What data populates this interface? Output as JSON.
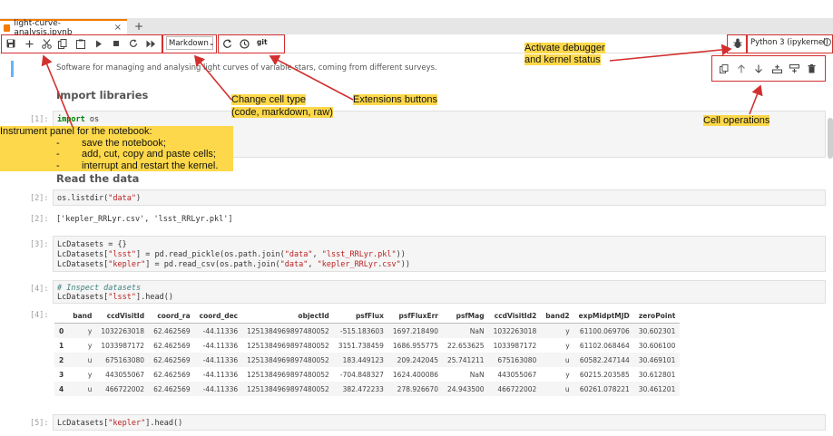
{
  "tab": {
    "title": "light-curve-analysis.ipynb",
    "close_glyph": "×",
    "new_tab_glyph": "+"
  },
  "toolbar": {
    "cell_type_value": "Markdown",
    "git_label": "git",
    "kernel_name": "Python 3 (ipykernel)",
    "icons": [
      "save-icon",
      "add-icon",
      "cut-icon",
      "copy-icon",
      "paste-icon",
      "run-icon",
      "stop-icon",
      "restart-icon",
      "fast-forward-icon",
      "refresh-icon",
      "clock-icon",
      "git-icon",
      "bug-icon",
      "kernel-status-icon"
    ]
  },
  "cell_ops": {
    "icons": [
      "duplicate-icon",
      "move-up-icon",
      "move-down-icon",
      "insert-above-icon",
      "insert-below-icon",
      "delete-icon"
    ]
  },
  "notebook": {
    "intro": "Software for managing and analysing light curves of variable stars, coming from different surveys.",
    "heading_import": "Import libraries",
    "heading_read": "Read the data",
    "cell1": {
      "prompt": "[1]:",
      "kw": "import",
      "rest": " os"
    },
    "cell2": {
      "prompt": "[2]:",
      "code_fn": "os.listdir(",
      "code_str": "\"data\"",
      "code_end": ")"
    },
    "out2": {
      "prompt": "[2]:",
      "text": "['kepler_RRLyr.csv', 'lsst_RRLyr.pkl']"
    },
    "cell3": {
      "prompt": "[3]:",
      "line1": "LcDatasets = {}",
      "line2a": "LcDatasets[",
      "line2b": "\"lsst\"",
      "line2c": "] = pd.read_pickle(os.path.join(",
      "line2d": "\"data\"",
      "line2e": ", ",
      "line2f": "\"lsst_RRLyr.pkl\"",
      "line2g": "))",
      "line3a": "LcDatasets[",
      "line3b": "\"kepler\"",
      "line3c": "] = pd.read_csv(os.path.join(",
      "line3d": "\"data\"",
      "line3e": ", ",
      "line3f": "\"kepler_RRLyr.csv\"",
      "line3g": "))"
    },
    "cell4": {
      "prompt": "[4]:",
      "comment": "# Inspect datasets",
      "line2a": "LcDatasets[",
      "line2b": "\"lsst\"",
      "line2c": "].head()"
    },
    "out4": {
      "prompt": "[4]:"
    },
    "cell5": {
      "prompt": "[5]:",
      "line1a": "LcDatasets[",
      "line1b": "\"kepler\"",
      "line1c": "].head()"
    }
  },
  "table": {
    "columns": [
      "",
      "band",
      "ccdVisitId",
      "coord_ra",
      "coord_dec",
      "objectId",
      "psfFlux",
      "psfFluxErr",
      "psfMag",
      "ccdVisitId2",
      "band2",
      "expMidptMJD",
      "zeroPoint"
    ],
    "rows": [
      [
        "0",
        "y",
        "1032263018",
        "62.462569",
        "-44.11336",
        "1251384969897480052",
        "-515.183603",
        "1697.218490",
        "NaN",
        "1032263018",
        "y",
        "61100.069706",
        "30.602301"
      ],
      [
        "1",
        "y",
        "1033987172",
        "62.462569",
        "-44.11336",
        "1251384969897480052",
        "3151.738459",
        "1686.955775",
        "22.653625",
        "1033987172",
        "y",
        "61102.068464",
        "30.606100"
      ],
      [
        "2",
        "u",
        "675163080",
        "62.462569",
        "-44.11336",
        "1251384969897480052",
        "183.449123",
        "209.242045",
        "25.741211",
        "675163080",
        "u",
        "60582.247144",
        "30.469101"
      ],
      [
        "3",
        "y",
        "443055067",
        "62.462569",
        "-44.11336",
        "1251384969897480052",
        "-704.848327",
        "1624.400086",
        "NaN",
        "443055067",
        "y",
        "60215.203585",
        "30.612801"
      ],
      [
        "4",
        "u",
        "466722002",
        "62.462569",
        "-44.11336",
        "1251384969897480052",
        "382.472233",
        "278.926670",
        "24.943500",
        "466722002",
        "u",
        "60261.078221",
        "30.461201"
      ]
    ]
  },
  "annotations": {
    "instrument_title": "Instrument panel for the notebook:",
    "instrument_items": [
      {
        "dash": "-",
        "text": "save the notebook;"
      },
      {
        "dash": "-",
        "text": "add, cut, copy and paste cells;"
      },
      {
        "dash": "-",
        "text": "interrupt and restart the kernel."
      }
    ],
    "celltype_line1": "Change cell type",
    "celltype_line2": "(code, markdown, raw)",
    "extensions": "Extensions buttons",
    "debugger_line1": "Activate debugger",
    "debugger_line2": "and kernel status",
    "cell_ops": "Cell operations"
  },
  "colors": {
    "accent": "#f57c00",
    "annotation_bg": "#fdd84a",
    "annotation_outline": "#d32f2f",
    "active_cell": "#64b5f6"
  }
}
